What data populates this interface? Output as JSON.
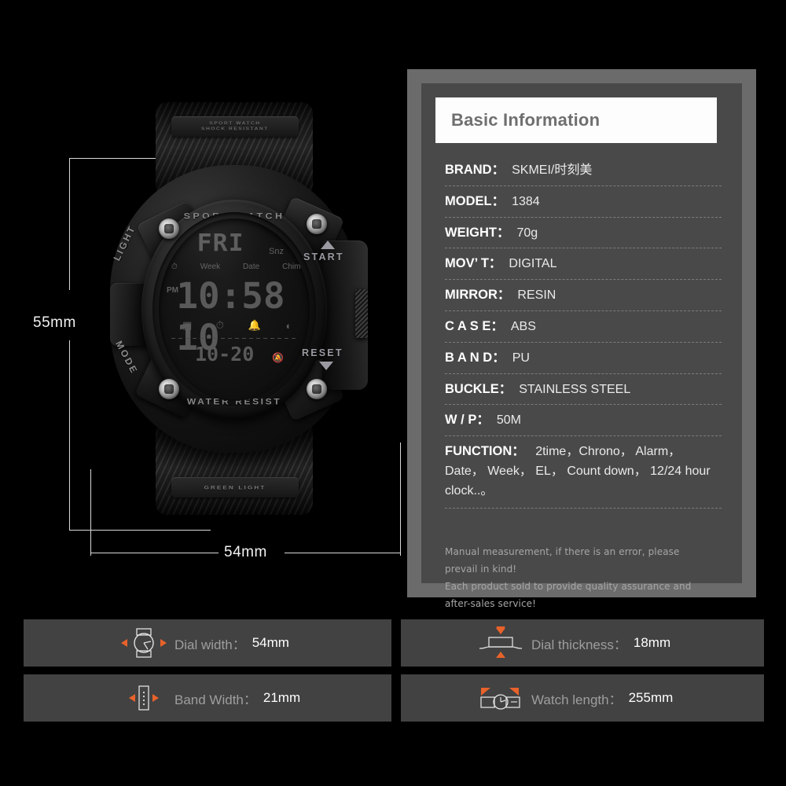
{
  "product": {
    "dimensions": {
      "height_label": "55mm",
      "width_label": "54mm"
    },
    "watch": {
      "bezel_top_text": "SPORT WATCH",
      "bezel_bottom_text": "WATER RESIST",
      "button_left_top": "LIGHT",
      "button_left_bottom": "MODE",
      "button_right_top": "START",
      "button_right_bottom": "RESET",
      "strap_top_line1": "SPORT WATCH",
      "strap_top_line2": "SHOCK RESISTANT",
      "strap_bottom_text": "GREEN LIGHT",
      "lcd": {
        "day": "FRI",
        "snooze": "Snz",
        "labels": [
          "(( ))",
          "Week",
          "Date",
          "Chime"
        ],
        "alarm_glyph": "♪",
        "ampm": "PM",
        "time": "10:58 10",
        "icons": [
          "calendar-icon",
          "stopwatch-icon",
          "bell-icon",
          "signal-icon"
        ],
        "sub_display": "10-20",
        "sub_icon": "bell-mute-icon"
      }
    }
  },
  "spec_panel": {
    "title": "Basic Information",
    "rows": [
      {
        "key": "BRAND",
        "colon": "：",
        "value": "SKMEI/时刻美",
        "spread": false
      },
      {
        "key": "MODEL",
        "colon": "：",
        "value": "1384",
        "spread": false
      },
      {
        "key": "WEIGHT",
        "colon": "：",
        "value": "70g",
        "spread": false
      },
      {
        "key": "MOV’ T",
        "colon": "：",
        "value": "DIGITAL",
        "spread": false
      },
      {
        "key": "MIRROR",
        "colon": "：",
        "value": "RESIN",
        "spread": false
      },
      {
        "key": "C A S E",
        "colon": "：",
        "value": "ABS",
        "spread": true
      },
      {
        "key": "B A N D",
        "colon": "：",
        "value": "PU",
        "spread": true
      },
      {
        "key": "BUCKLE",
        "colon": "：",
        "value": "STAINLESS STEEL",
        "spread": false
      },
      {
        "key": "W / P",
        "colon": "：",
        "value": "50M",
        "spread": true
      }
    ],
    "function_row": {
      "key": "FUNCTION",
      "colon": "：",
      "value": "2time，Chrono， Alarm， Date， Week， EL， Count down， 12/24 hour clock..。"
    },
    "notes": [
      "Manual measurement, if there is an error, please prevail in kind!",
      "Each product sold to provide quality assurance and after-sales service!"
    ]
  },
  "measure_cards": [
    {
      "icon": "watch-dial-width-icon",
      "label": "Dial width：",
      "value": "54mm"
    },
    {
      "icon": "watch-thickness-icon",
      "label": "Dial thickness：",
      "value": "18mm"
    },
    {
      "icon": "band-width-icon",
      "label": "Band Width：",
      "value": "21mm"
    },
    {
      "icon": "watch-length-icon",
      "label": "Watch length：",
      "value": "255mm"
    }
  ],
  "colors": {
    "background": "#000000",
    "panel_outer": "#6b6b6b",
    "panel_inner": "#494949",
    "title_bar": "#fdfdfd",
    "title_text": "#6f6f6f",
    "card": "#424242",
    "accent_orange": "#e8622a",
    "dim_line": "#d9d9d9"
  }
}
